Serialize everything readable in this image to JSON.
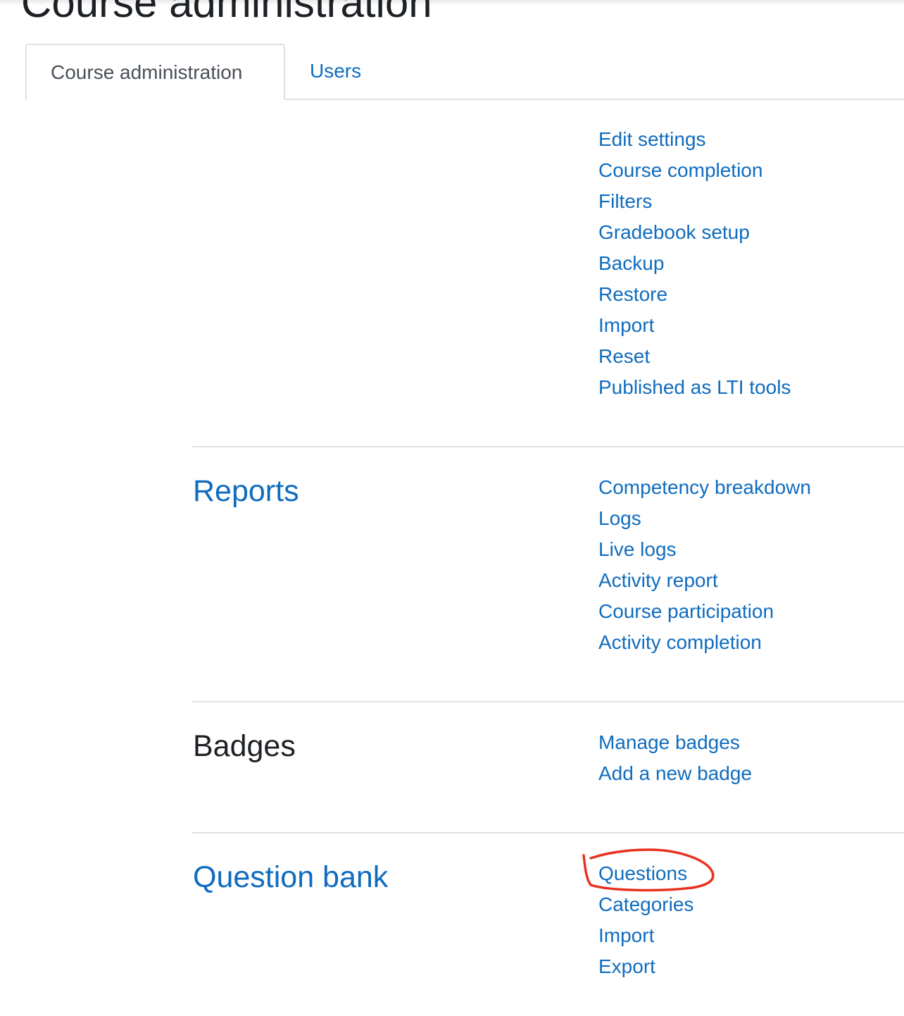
{
  "page": {
    "title": "Course administration"
  },
  "tabs": [
    {
      "label": "Course administration",
      "active": true
    },
    {
      "label": "Users",
      "active": false
    }
  ],
  "course_settings": {
    "links": [
      "Edit settings",
      "Course completion",
      "Filters",
      "Gradebook setup",
      "Backup",
      "Restore",
      "Import",
      "Reset",
      "Published as LTI tools"
    ]
  },
  "reports": {
    "heading": "Reports",
    "links": [
      "Competency breakdown",
      "Logs",
      "Live logs",
      "Activity report",
      "Course participation",
      "Activity completion"
    ]
  },
  "badges": {
    "heading": "Badges",
    "links": [
      "Manage badges",
      "Add a new badge"
    ]
  },
  "question_bank": {
    "heading": "Question bank",
    "links": [
      "Questions",
      "Categories",
      "Import",
      "Export"
    ]
  },
  "annotation": {
    "circled_item": "Questions",
    "color": "#e8321f"
  },
  "colors": {
    "link": "#0f6cbf",
    "text": "#1d2125",
    "muted_tab": "#495057",
    "border": "#dee2e6"
  }
}
